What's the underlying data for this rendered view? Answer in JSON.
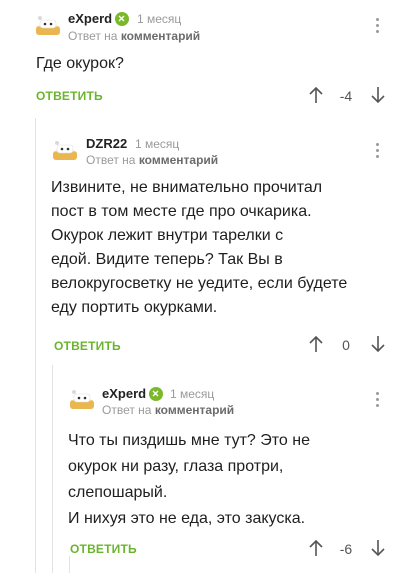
{
  "reply_to_prefix": "Ответ на",
  "reply_to_link": "комментарий",
  "reply_button": "ОТВЕТИТЬ",
  "colors": {
    "accent": "#6bb52e",
    "verified": "#7ab929",
    "muted": "#9a9a9a"
  },
  "comments": [
    {
      "username": "eXperd",
      "verified": true,
      "time": "1 месяц",
      "text": "Где окурок?",
      "rating": "-4"
    },
    {
      "username": "DZR22",
      "verified": false,
      "time": "1 месяц",
      "text": "Извините, не внимательно прочитал\nпост в том месте где про очкарика.\nОкурок лежит внутри тарелки с\nедой. Видите теперь? Так Вы  в\nвелокругосветку не уедите, если будете\nеду портить окурками.",
      "rating": "0"
    },
    {
      "username": "eXperd",
      "verified": true,
      "time": "1 месяц",
      "text": "Что ты пиздишь мне тут?  Это не\nокурок ни разу,  глаза протри,\nслепошарый.\nИ нихуя это не еда,  это закуска.",
      "rating": "-6"
    }
  ]
}
